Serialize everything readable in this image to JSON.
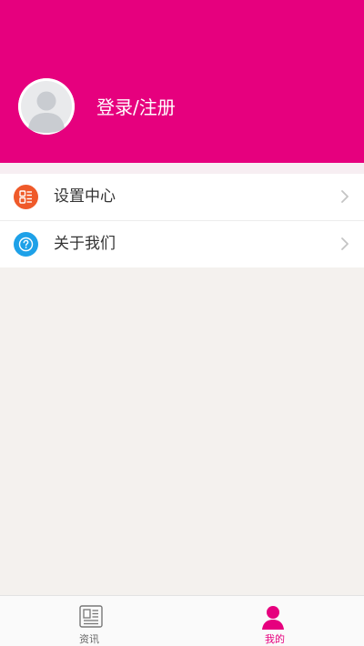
{
  "header": {
    "login_label": "登录/注册",
    "background_color": "#e6007e"
  },
  "menu": {
    "items": [
      {
        "label": "设置中心",
        "icon": "settings-grid-icon",
        "icon_color": "#ef5a2a"
      },
      {
        "label": "关于我们",
        "icon": "help-question-icon",
        "icon_color": "#1ea1e8"
      }
    ]
  },
  "tabbar": {
    "tabs": [
      {
        "label": "资讯",
        "icon": "newspaper-icon",
        "active": false
      },
      {
        "label": "我的",
        "icon": "user-icon",
        "active": true
      }
    ],
    "active_color": "#e6007e",
    "inactive_color": "#666666"
  }
}
